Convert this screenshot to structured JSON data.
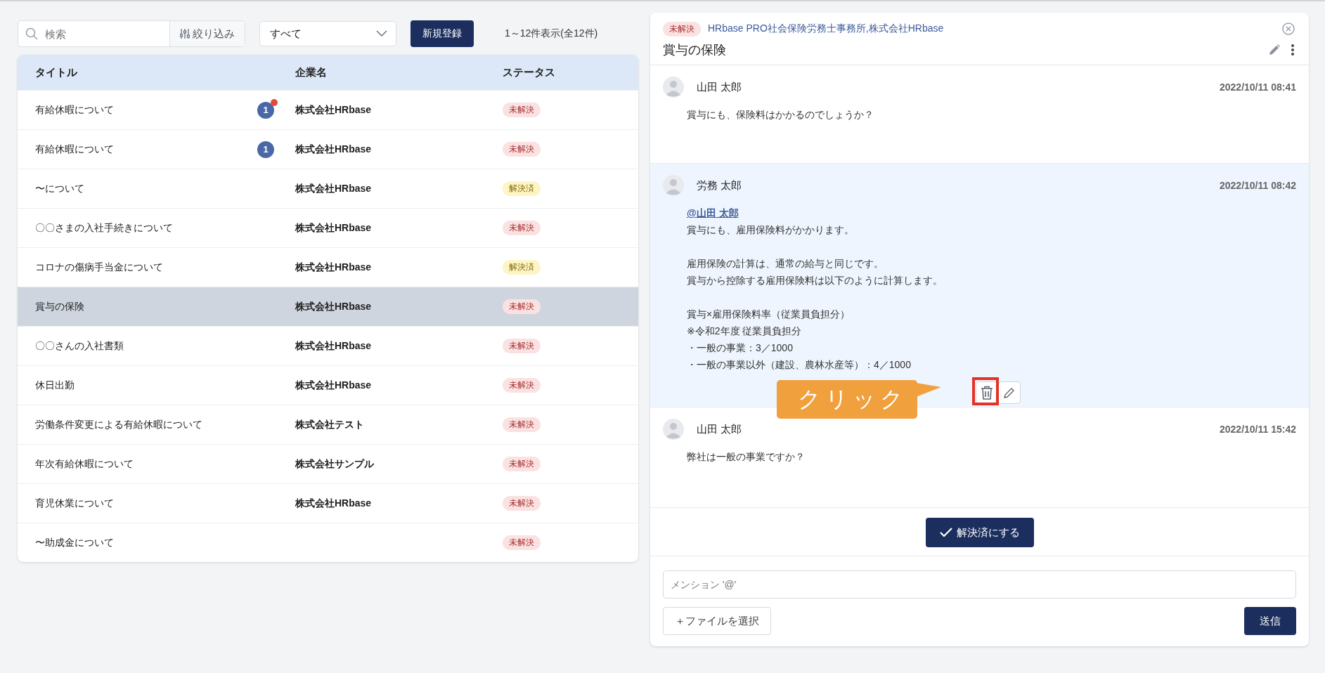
{
  "toolbar": {
    "search": {
      "placeholder": "検索"
    },
    "filter_button": "絞り込み",
    "status_select": {
      "value": "すべて"
    },
    "new_button": "新規登録",
    "count": "1～12件表示(全12件)"
  },
  "table": {
    "columns": [
      "タイトル",
      "企業名",
      "ステータス"
    ],
    "rows": [
      {
        "title": "有給休暇について",
        "unread": "1",
        "new": true,
        "company": "株式会社HRbase",
        "status": "未解決",
        "kind": "unresolved",
        "selected": false
      },
      {
        "title": "有給休暇について",
        "unread": "1",
        "new": false,
        "company": "株式会社HRbase",
        "status": "未解決",
        "kind": "unresolved",
        "selected": false
      },
      {
        "title": "〜について",
        "company": "株式会社HRbase",
        "status": "解決済",
        "kind": "resolved",
        "selected": false
      },
      {
        "title": "〇〇さまの入社手続きについて",
        "company": "株式会社HRbase",
        "status": "未解決",
        "kind": "unresolved",
        "selected": false
      },
      {
        "title": "コロナの傷病手当金について",
        "company": "株式会社HRbase",
        "status": "解決済",
        "kind": "resolved",
        "selected": false
      },
      {
        "title": "賞与の保険",
        "company": "株式会社HRbase",
        "status": "未解決",
        "kind": "unresolved",
        "selected": true
      },
      {
        "title": "〇〇さんの入社書類",
        "company": "株式会社HRbase",
        "status": "未解決",
        "kind": "unresolved",
        "selected": false
      },
      {
        "title": "休日出勤",
        "company": "株式会社HRbase",
        "status": "未解決",
        "kind": "unresolved",
        "selected": false
      },
      {
        "title": "労働条件変更による有給休暇について",
        "company": "株式会社テスト",
        "status": "未解決",
        "kind": "unresolved",
        "selected": false
      },
      {
        "title": "年次有給休暇について",
        "company": "株式会社サンプル",
        "status": "未解決",
        "kind": "unresolved",
        "selected": false
      },
      {
        "title": "育児休業について",
        "company": "株式会社HRbase",
        "status": "未解決",
        "kind": "unresolved",
        "selected": false
      },
      {
        "title": "〜助成金について",
        "status": "未解決",
        "kind": "unresolved",
        "selected": false
      }
    ]
  },
  "detail": {
    "status": {
      "label": "未解決",
      "kind": "unresolved"
    },
    "participants": "HRbase PRO社会保険労務士事務所,株式会社HRbase",
    "title": "賞与の保険",
    "messages": [
      {
        "author": "山田 太郎",
        "time": "2022/10/11 08:41",
        "highlighted": false,
        "paragraphs": [
          [
            "賞与にも、保険料はかかるのでしょうか？"
          ]
        ]
      },
      {
        "author": "労務 太郎",
        "time": "2022/10/11 08:42",
        "highlighted": true,
        "mention": "@山田 太郎",
        "paragraphs": [
          [
            "賞与にも、雇用保険料がかかります。"
          ],
          [
            "雇用保険の計算は、通常の給与と同じです。",
            "賞与から控除する雇用保険料は以下のように計算します。"
          ],
          [
            "賞与×雇用保険料率（従業員負担分）",
            "※令和2年度 従業員負担分",
            "・一般の事業：3／1000",
            "・一般の事業以外（建設、農林水産等）：4／1000"
          ]
        ],
        "actions": true,
        "callout": "クリック"
      },
      {
        "author": "山田 太郎",
        "time": "2022/10/11 15:42",
        "highlighted": false,
        "paragraphs": [
          [
            "弊社は一般の事業ですか？"
          ]
        ]
      }
    ],
    "resolve_button": "解決済にする",
    "compose": {
      "placeholder": "メンション '@'"
    },
    "file_button": "＋ファイルを選択",
    "send_button": "送信"
  }
}
